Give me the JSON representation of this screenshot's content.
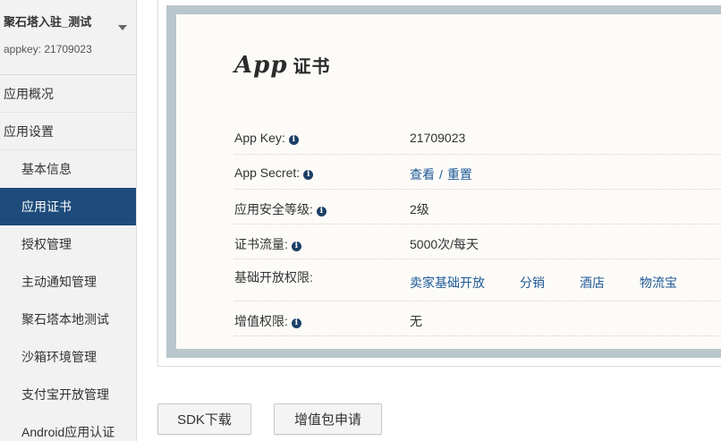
{
  "sidebar": {
    "app_name": "聚石塔入驻_测试",
    "app_key_line": "appkey: 21709023",
    "nav": [
      {
        "label": "应用概况",
        "sub": false,
        "active": false
      },
      {
        "label": "应用设置",
        "sub": false,
        "active": false
      },
      {
        "label": "基本信息",
        "sub": true,
        "active": false
      },
      {
        "label": "应用证书",
        "sub": true,
        "active": true
      },
      {
        "label": "授权管理",
        "sub": true,
        "active": false
      },
      {
        "label": "主动通知管理",
        "sub": true,
        "active": false
      },
      {
        "label": "聚石塔本地测试",
        "sub": true,
        "active": false
      },
      {
        "label": "沙箱环境管理",
        "sub": true,
        "active": false
      },
      {
        "label": "支付宝开放管理",
        "sub": true,
        "active": false
      },
      {
        "label": "Android应用认证",
        "sub": true,
        "active": false
      }
    ]
  },
  "certificate": {
    "title_latin": "App",
    "title_cn": "证书",
    "rows": {
      "app_key": {
        "label": "App Key:",
        "value": "21709023"
      },
      "app_secret": {
        "label": "App Secret:",
        "view": "查看",
        "separator": "/",
        "reset": "重置"
      },
      "security_level": {
        "label": "应用安全等级:",
        "value": "2级"
      },
      "traffic": {
        "label": "证书流量:",
        "value": "5000次/每天"
      },
      "basic_perms": {
        "label": "基础开放权限:",
        "items": [
          "卖家基础开放",
          "分销",
          "酒店",
          "物流宝"
        ]
      },
      "value_added": {
        "label": "增值权限:",
        "value": "无"
      }
    },
    "info_glyph": "i"
  },
  "buttons": {
    "sdk_download": "SDK下载",
    "value_added_apply": "增值包申请"
  },
  "colors": {
    "sidebar_active": "#1e4b7b",
    "link": "#1e5a96",
    "frame": "#b9c6cc",
    "cert_bg": "#fdfbf8"
  }
}
